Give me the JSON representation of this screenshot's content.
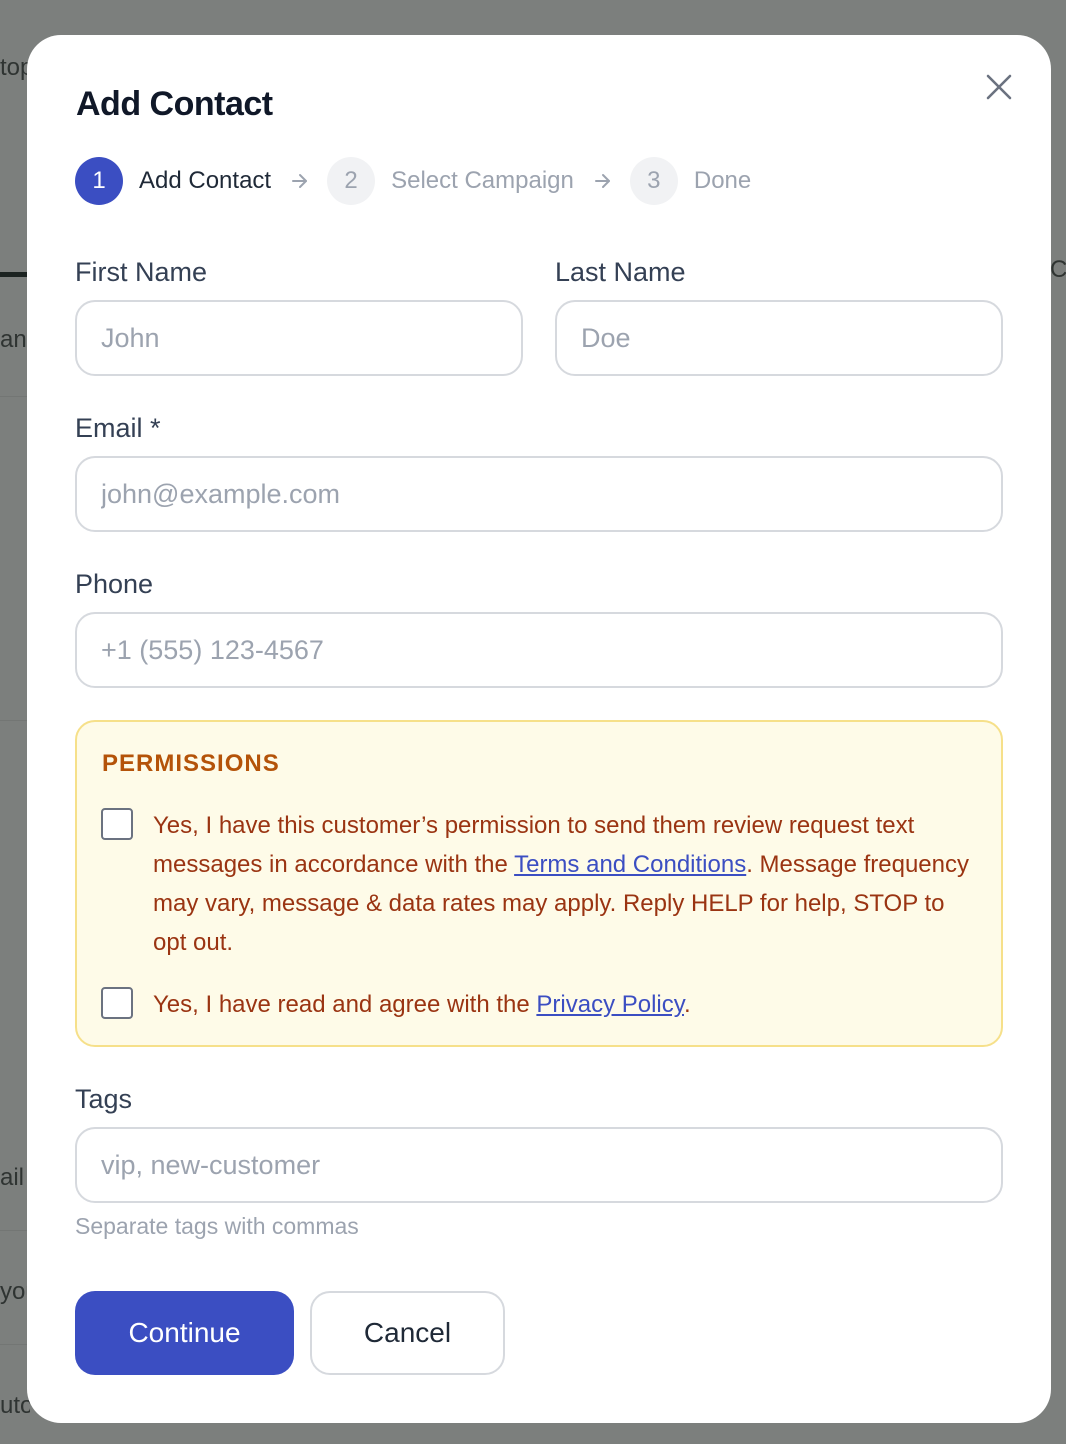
{
  "background": {
    "fragments": [
      "top",
      "an",
      "ail",
      "you",
      "uto"
    ],
    "fragment_right": "Co"
  },
  "modal": {
    "title": "Add Contact",
    "steps": [
      {
        "number": "1",
        "label": "Add Contact",
        "state": "active"
      },
      {
        "number": "2",
        "label": "Select Campaign",
        "state": "inactive"
      },
      {
        "number": "3",
        "label": "Done",
        "state": "inactive"
      }
    ]
  },
  "form": {
    "first_name": {
      "label": "First Name",
      "placeholder": "John",
      "value": ""
    },
    "last_name": {
      "label": "Last Name",
      "placeholder": "Doe",
      "value": ""
    },
    "email": {
      "label": "Email *",
      "placeholder": "john@example.com",
      "value": ""
    },
    "phone": {
      "label": "Phone",
      "placeholder": "+1 (555) 123-4567",
      "value": ""
    },
    "permissions": {
      "title": "PERMISSIONS",
      "sms_consent": {
        "checked": false,
        "text_before": "Yes, I have this customer’s permission to send them review request text messages in accordance with the ",
        "link": "Terms and Conditions",
        "text_after": ". Message frequency may vary, message & data rates may apply. Reply HELP for help, STOP to opt out."
      },
      "privacy_consent": {
        "checked": false,
        "text_before": "Yes, I have read and agree with the ",
        "link": "Privacy Policy",
        "text_after": "."
      }
    },
    "tags": {
      "label": "Tags",
      "placeholder": "vip, new-customer",
      "value": "",
      "hint": "Separate tags with commas"
    }
  },
  "actions": {
    "continue_label": "Continue",
    "cancel_label": "Cancel"
  },
  "colors": {
    "primary": "#3b4ec2",
    "overlay": "#7c7f7d",
    "permissions_bg": "#fefbe8",
    "permissions_border": "#f6e08a",
    "permissions_text": "#9a3412"
  },
  "icons": {
    "close": "close-icon",
    "step_arrow": "arrow-right-icon"
  }
}
